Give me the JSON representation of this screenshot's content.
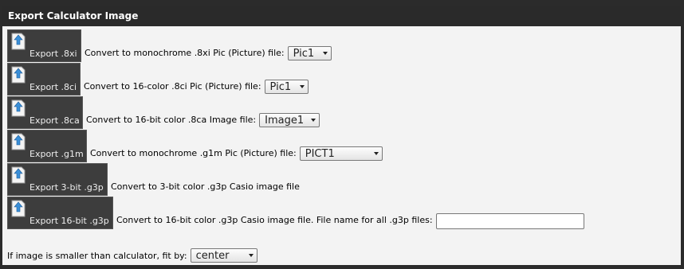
{
  "header": {
    "title": "Export Calculator Image"
  },
  "rows": [
    {
      "button": "Export .8xi",
      "description": "Convert to monochrome .8xi Pic (Picture) file:",
      "select": "Pic1"
    },
    {
      "button": "Export .8ci",
      "description": "Convert to 16-color .8ci Pic (Picture) file:",
      "select": "Pic1"
    },
    {
      "button": "Export .8ca",
      "description": "Convert to 16-bit color .8ca Image file:",
      "select": "Image1"
    },
    {
      "button": "Export .g1m",
      "description": "Convert to monochrome .g1m Pic (Picture) file:",
      "select": "PICT1"
    },
    {
      "button": "Export 3-bit .g3p",
      "description": "Convert to 3-bit color .g3p Casio image file"
    },
    {
      "button": "Export 16-bit .g3p",
      "description": "Convert to 16-bit color .g3p Casio image file. File name for all .g3p files:",
      "input_value": ""
    }
  ],
  "fit": {
    "label": "If image is smaller than calculator, fit by:",
    "select": "center"
  },
  "colors": {
    "header_bg": "#2a2a2a",
    "panel_bg": "#f3f3f3",
    "button_bg": "#3d3d3d",
    "icon_accent": "#3a8fd8"
  },
  "icons": {
    "export": "export-upload-icon",
    "dropdown": "chevron-down-icon"
  }
}
